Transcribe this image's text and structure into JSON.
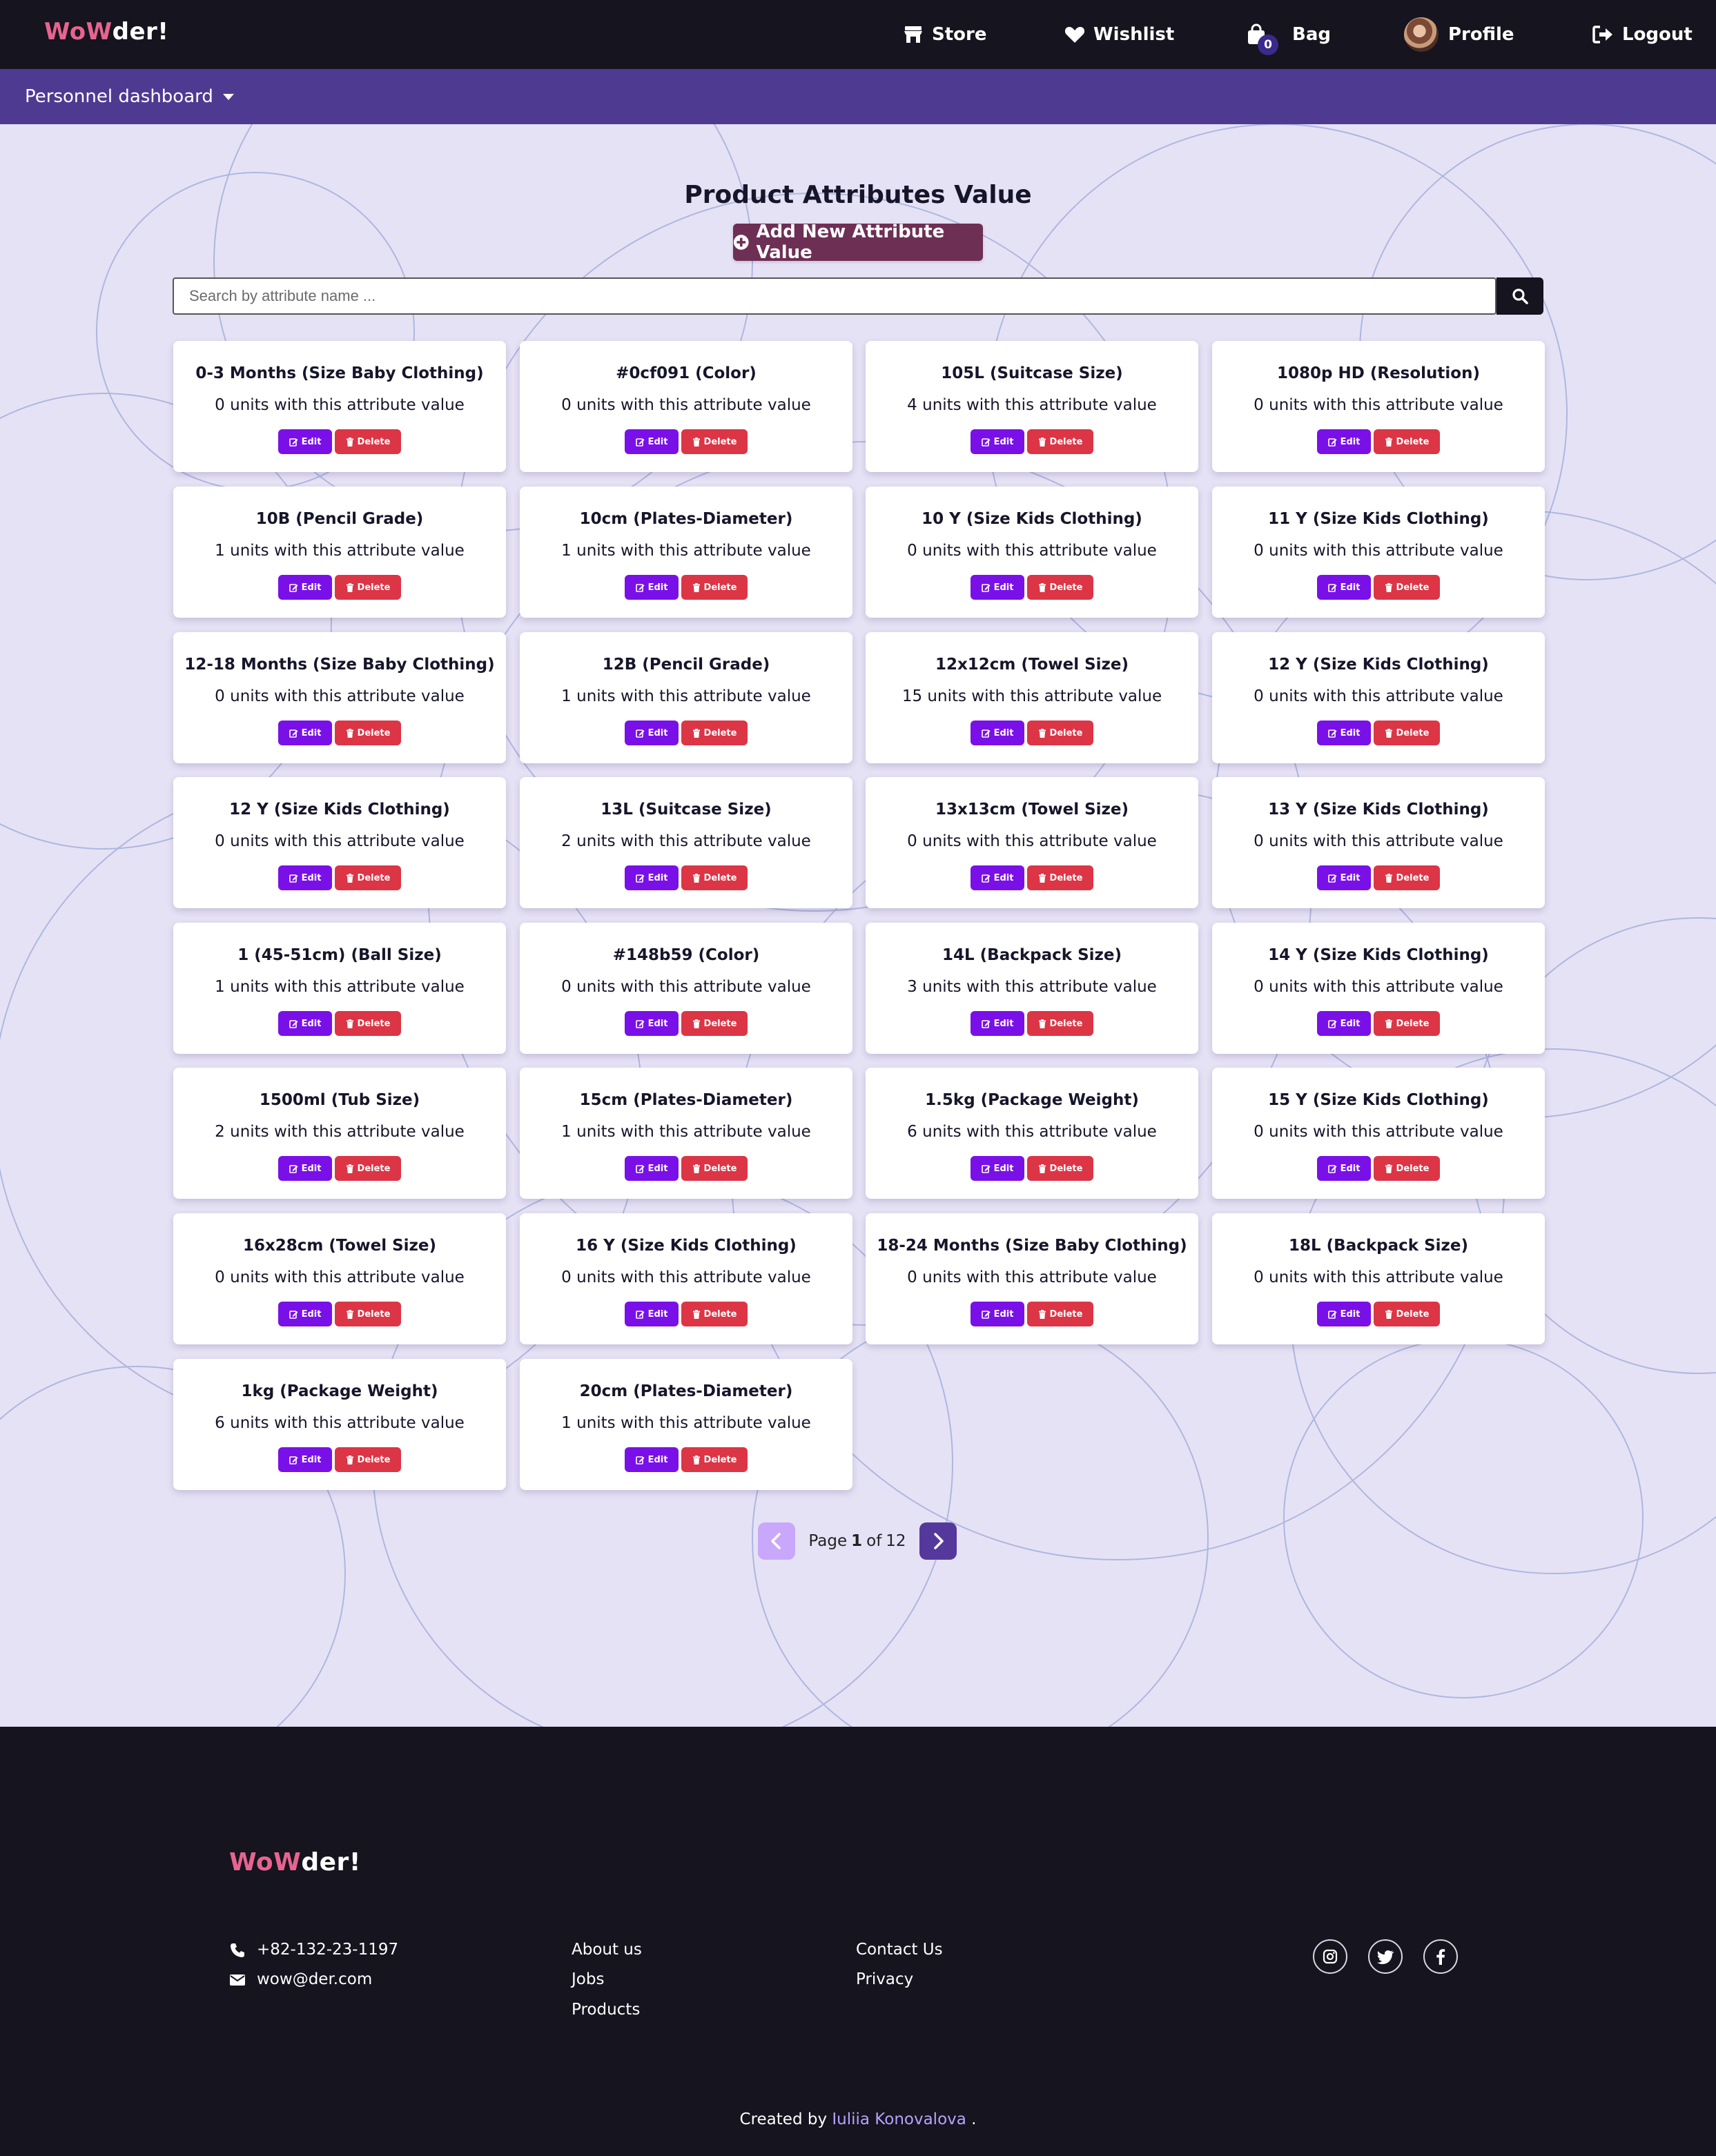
{
  "brand": {
    "part1": "WoW",
    "part2": "der!"
  },
  "nav": {
    "store": "Store",
    "wishlist": "Wishlist",
    "bag": "Bag",
    "bag_count": "0",
    "profile": "Profile",
    "logout": "Logout"
  },
  "subnav": {
    "dashboard": "Personnel dashboard"
  },
  "main": {
    "title": "Product Attributes Value",
    "add_button": "Add New Attribute Value",
    "search_placeholder": "Search by attribute name ...",
    "edit_label": "Edit",
    "delete_label": "Delete"
  },
  "cards": [
    {
      "title": "0-3 Months (Size Baby Clothing)",
      "units": "0 units with this attribute value"
    },
    {
      "title": "#0cf091 (Color)",
      "units": "0 units with this attribute value"
    },
    {
      "title": "105L (Suitcase Size)",
      "units": "4 units with this attribute value"
    },
    {
      "title": "1080p HD (Resolution)",
      "units": "0 units with this attribute value"
    },
    {
      "title": "10B (Pencil Grade)",
      "units": "1 units with this attribute value"
    },
    {
      "title": "10cm (Plates-Diameter)",
      "units": "1 units with this attribute value"
    },
    {
      "title": "10 Y (Size Kids Clothing)",
      "units": "0 units with this attribute value"
    },
    {
      "title": "11 Y (Size Kids Clothing)",
      "units": "0 units with this attribute value"
    },
    {
      "title": "12-18 Months (Size Baby Clothing)",
      "units": "0 units with this attribute value"
    },
    {
      "title": "12B (Pencil Grade)",
      "units": "1 units with this attribute value"
    },
    {
      "title": "12x12cm (Towel Size)",
      "units": "15 units with this attribute value"
    },
    {
      "title": "12 Y (Size Kids Clothing)",
      "units": "0 units with this attribute value"
    },
    {
      "title": "12 Y (Size Kids Clothing)",
      "units": "0 units with this attribute value"
    },
    {
      "title": "13L (Suitcase Size)",
      "units": "2 units with this attribute value"
    },
    {
      "title": "13x13cm (Towel Size)",
      "units": "0 units with this attribute value"
    },
    {
      "title": "13 Y (Size Kids Clothing)",
      "units": "0 units with this attribute value"
    },
    {
      "title": "1 (45-51cm) (Ball Size)",
      "units": "1 units with this attribute value"
    },
    {
      "title": "#148b59 (Color)",
      "units": "0 units with this attribute value"
    },
    {
      "title": "14L (Backpack Size)",
      "units": "3 units with this attribute value"
    },
    {
      "title": "14 Y (Size Kids Clothing)",
      "units": "0 units with this attribute value"
    },
    {
      "title": "1500ml (Tub Size)",
      "units": "2 units with this attribute value"
    },
    {
      "title": "15cm (Plates-Diameter)",
      "units": "1 units with this attribute value"
    },
    {
      "title": "1.5kg (Package Weight)",
      "units": "6 units with this attribute value"
    },
    {
      "title": "15 Y (Size Kids Clothing)",
      "units": "0 units with this attribute value"
    },
    {
      "title": "16x28cm (Towel Size)",
      "units": "0 units with this attribute value"
    },
    {
      "title": "16 Y (Size Kids Clothing)",
      "units": "0 units with this attribute value"
    },
    {
      "title": "18-24 Months (Size Baby Clothing)",
      "units": "0 units with this attribute value"
    },
    {
      "title": "18L (Backpack Size)",
      "units": "0 units with this attribute value"
    },
    {
      "title": "1kg (Package Weight)",
      "units": "6 units with this attribute value"
    },
    {
      "title": "20cm (Plates-Diameter)",
      "units": "1 units with this attribute value"
    }
  ],
  "pagination": {
    "prefix": "Page",
    "current": "1",
    "separator": "of",
    "total": "12"
  },
  "footer": {
    "phone": "+82-132-23-1197",
    "email": "wow@der.com",
    "links_col1": [
      "About us",
      "Jobs",
      "Products"
    ],
    "links_col2": [
      "Contact Us",
      "Privacy"
    ],
    "social_icons": [
      "instagram-icon",
      "twitter-icon",
      "facebook-icon"
    ],
    "credit_prefix": "Created by",
    "credit_author": "Iuliia Konovalova",
    "credit_suffix": "."
  },
  "colors": {
    "navbar": "#15141f",
    "subnav": "#4f3a92",
    "page_bg": "#e6e2f5",
    "brand_pink": "#e7648f",
    "add_button": "#6e2f55",
    "edit_button": "#7a10e8",
    "delete_button": "#dc3545",
    "pagination_active": "#55389c",
    "pagination_disabled": "#c9a8fb"
  }
}
